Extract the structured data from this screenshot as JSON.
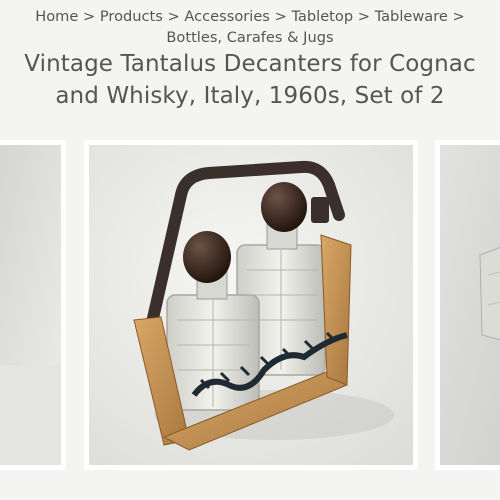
{
  "breadcrumb": {
    "items": [
      "Home",
      "Products",
      "Accessories",
      "Tabletop",
      "Tableware",
      "Bottles, Carafes & Jugs"
    ],
    "separator": ">"
  },
  "product": {
    "title_line1": "Vintage Tantalus Decanters for Cognac",
    "title_line2": "and Whisky, Italy, 1960s, Set of 2"
  },
  "gallery": {
    "images": [
      "previous-product-image",
      "tantalus-decanters-photo",
      "next-product-image"
    ]
  },
  "colors": {
    "background": "#f4f4f2",
    "text": "#555555",
    "frame": "#ffffff",
    "wood": "#c9975a",
    "leather": "#3a2f2a",
    "stopper": "#3b2a22"
  }
}
